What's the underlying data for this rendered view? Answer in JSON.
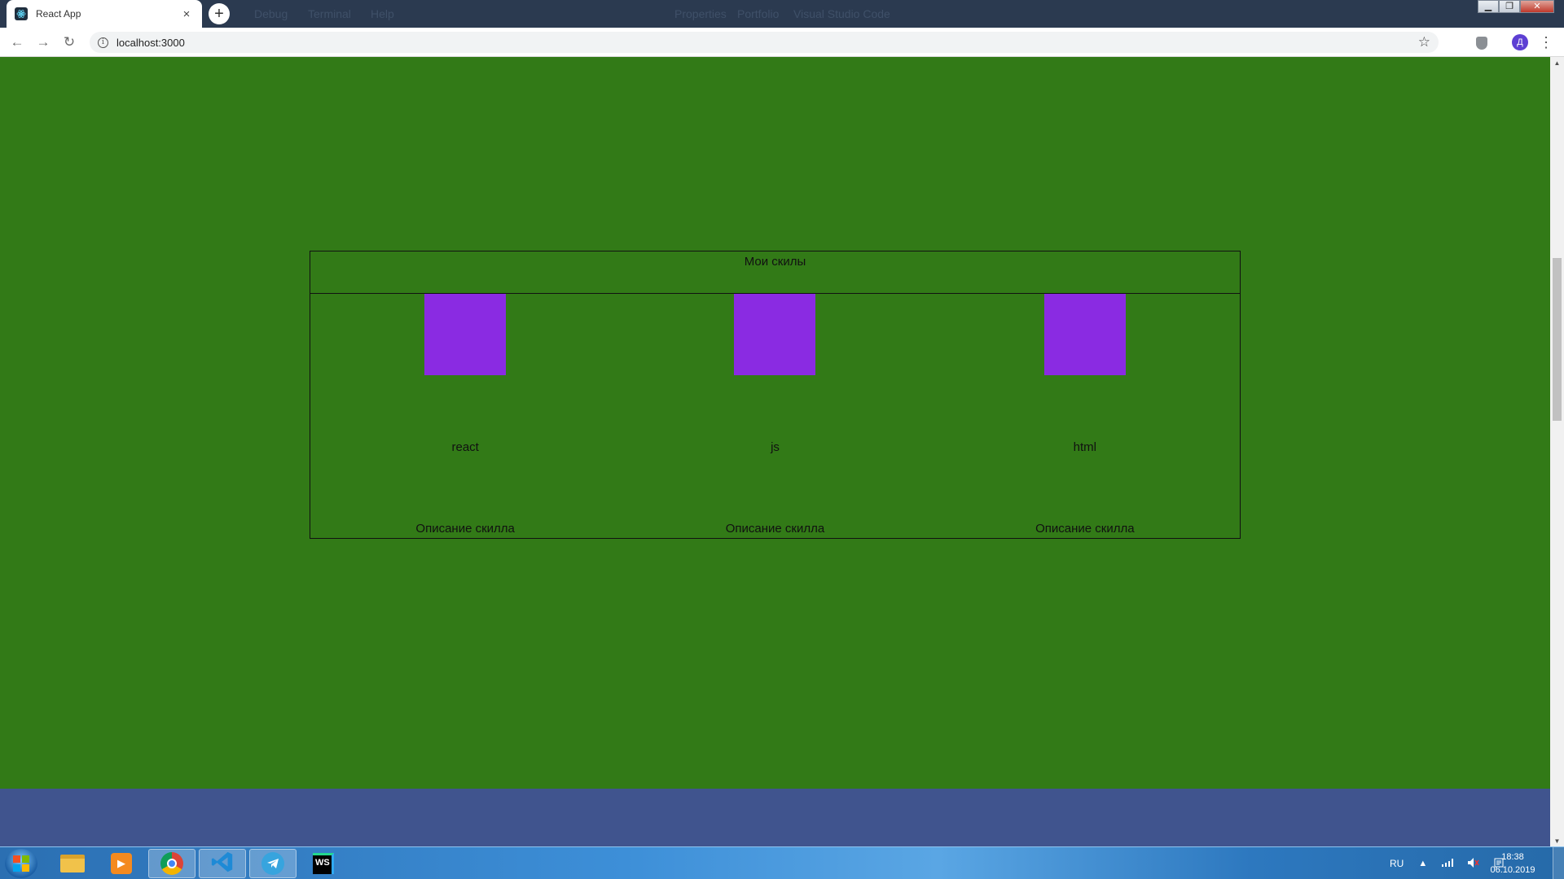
{
  "browser": {
    "tab_title": "React App",
    "tab_close": "×",
    "new_tab": "+",
    "url": "localhost:3000",
    "star": "☆",
    "avatar_letter": "Д",
    "menu": "⋮",
    "back": "←",
    "forward": "→",
    "reload": "↻",
    "info": "i",
    "window_controls": {
      "minimize": "▁",
      "restore": "❐",
      "close": "✕"
    },
    "ghost_menu": [
      "Debug",
      "Terminal",
      "Help"
    ],
    "ghost_title": [
      "Properties",
      "Portfolio",
      "Visual Studio Code"
    ]
  },
  "page": {
    "background_color": "#327a17",
    "footer_color": "#40548e",
    "skills_title": "Мои скилы",
    "skills": [
      {
        "name": "react",
        "description": "Описание скилла",
        "image_color": "#8a2be2"
      },
      {
        "name": "js",
        "description": "Описание скилла",
        "image_color": "#8a2be2"
      },
      {
        "name": "html",
        "description": "Описание скилла",
        "image_color": "#8a2be2"
      }
    ]
  },
  "scrollbar": {
    "up": "▲",
    "down": "▼"
  },
  "taskbar": {
    "apps": [
      {
        "name": "file-explorer-icon",
        "active": false
      },
      {
        "name": "media-player-icon",
        "active": false
      },
      {
        "name": "chrome-icon",
        "active": true
      },
      {
        "name": "vscode-icon",
        "active": true
      },
      {
        "name": "telegram-icon",
        "active": true
      },
      {
        "name": "webstorm-icon",
        "active": false
      }
    ],
    "webstorm_label": "WS",
    "language": "RU",
    "tray_arrow": "▲",
    "time": "18:38",
    "date": "06.10.2019"
  }
}
